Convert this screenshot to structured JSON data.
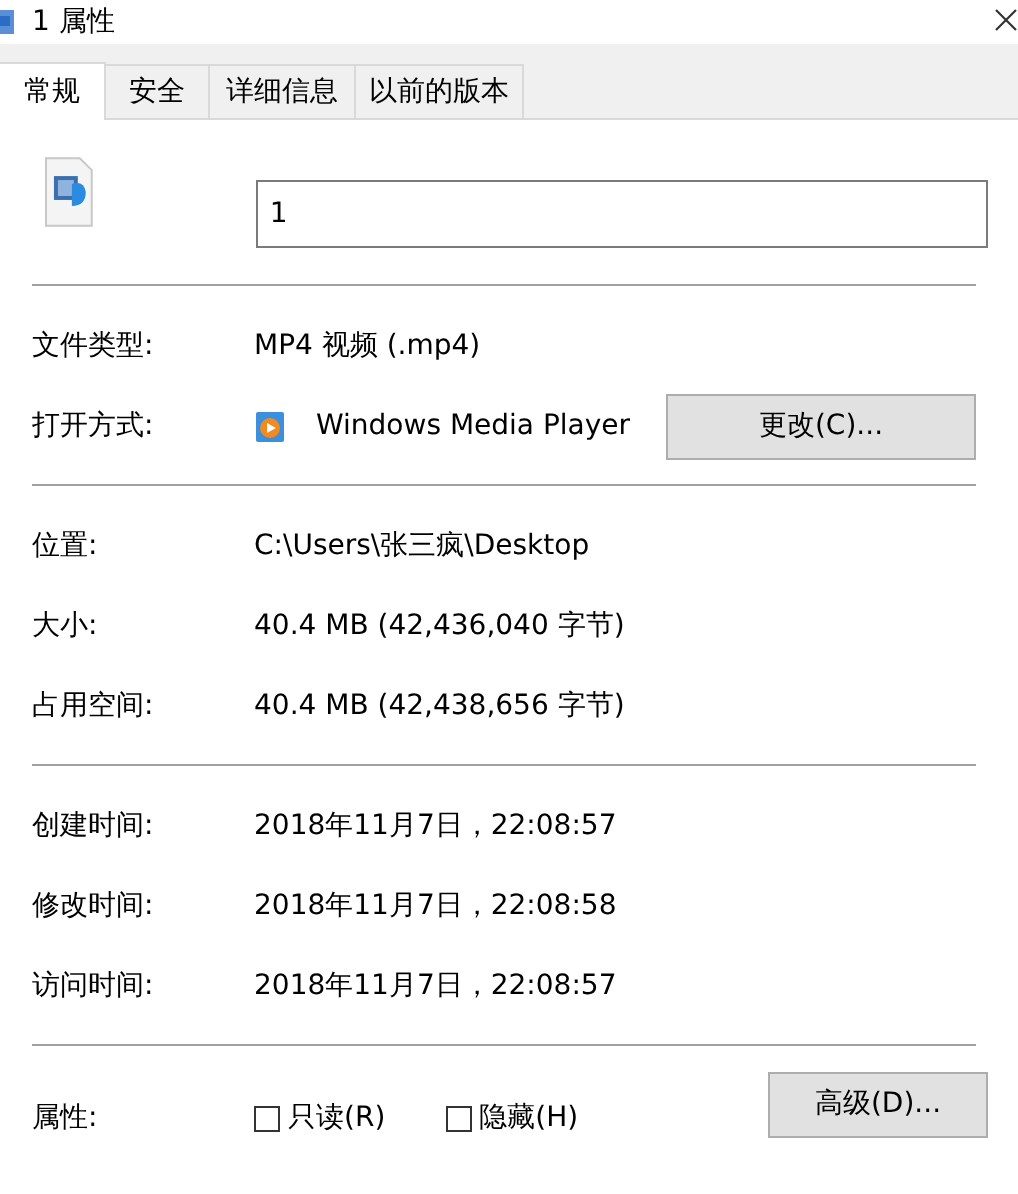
{
  "window": {
    "title": "1 属性"
  },
  "tabs": [
    {
      "label": "常规",
      "selected": true
    },
    {
      "label": "安全",
      "selected": false
    },
    {
      "label": "详细信息",
      "selected": false
    },
    {
      "label": "以前的版本",
      "selected": false
    }
  ],
  "file_name": {
    "value": "1"
  },
  "sections": [
    [
      {
        "kind": "text",
        "label": "文件类型:",
        "value": "MP4 视频 (.mp4)"
      },
      {
        "kind": "app",
        "label": "打开方式:",
        "value": "Windows Media Player",
        "button": "更改(C)..."
      }
    ],
    [
      {
        "kind": "text",
        "label": "位置:",
        "value": "C:\\Users\\张三疯\\Desktop"
      },
      {
        "kind": "text",
        "label": "大小:",
        "value": "40.4 MB (42,436,040 字节)"
      },
      {
        "kind": "text",
        "label": "占用空间:",
        "value": "40.4 MB (42,438,656 字节)"
      }
    ],
    [
      {
        "kind": "text",
        "label": "创建时间:",
        "value": "2018年11月7日，22:08:57"
      },
      {
        "kind": "text",
        "label": "修改时间:",
        "value": "2018年11月7日，22:08:58"
      },
      {
        "kind": "text",
        "label": "访问时间:",
        "value": "2018年11月7日，22:08:57"
      }
    ]
  ],
  "attributes": {
    "label": "属性:",
    "checkboxes": [
      {
        "label": "只读(R)",
        "checked": false
      },
      {
        "label": "隐藏(H)",
        "checked": false
      }
    ],
    "button": "高级(D)..."
  }
}
